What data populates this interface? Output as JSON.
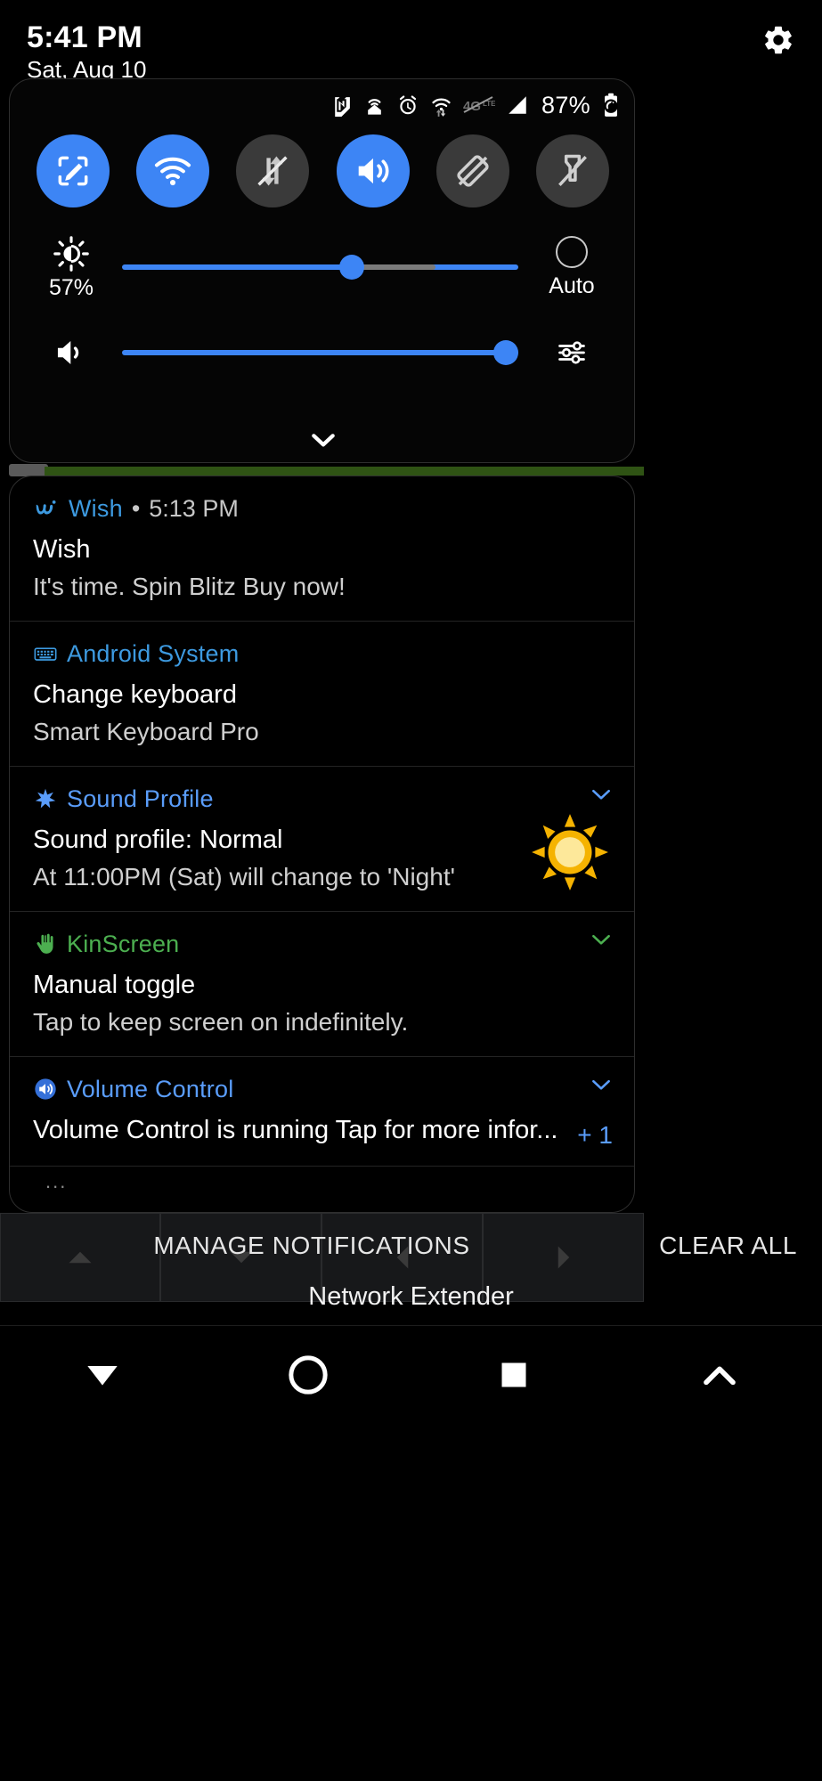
{
  "statusbar_clock": {
    "time": "5:41 PM",
    "date": "Sat, Aug 10",
    "settings_icon": "gear-icon"
  },
  "statusbar": {
    "icons": [
      "nfc-icon",
      "smart-home-icon",
      "alarm-icon",
      "wifi-transfer-icon",
      "4g-lte-disabled-icon",
      "signal-bars-icon"
    ],
    "battery_percent": "87%",
    "battery_icon": "battery-charging-icon",
    "network_label": "4G LTE"
  },
  "quick_settings": {
    "toggles": [
      {
        "name": "screenshot-markup-toggle",
        "icon": "capture-pen-icon",
        "state": "on"
      },
      {
        "name": "wifi-toggle",
        "icon": "wifi-icon",
        "state": "on"
      },
      {
        "name": "mobile-data-toggle",
        "icon": "data-off-icon",
        "state": "off"
      },
      {
        "name": "sound-toggle",
        "icon": "volume-on-icon",
        "state": "on"
      },
      {
        "name": "auto-rotate-toggle",
        "icon": "rotate-locked-icon",
        "state": "off"
      },
      {
        "name": "flashlight-toggle",
        "icon": "flashlight-off-icon",
        "state": "off"
      }
    ],
    "brightness": {
      "icon": "brightness-icon",
      "value_label": "57%",
      "value": 57,
      "auto_label": "Auto",
      "auto_enabled": false
    },
    "volume": {
      "icon": "speaker-icon",
      "value": 100,
      "settings_icon": "sliders-icon"
    },
    "expand_icon": "chevron-down-icon"
  },
  "notifications": [
    {
      "app": "Wish",
      "app_color": "#3d9ae0",
      "icon": "wish-logo-icon",
      "separator": "•",
      "time": "5:13 PM",
      "title": "Wish",
      "body": "It's time. Spin Blitz Buy now!",
      "has_chevron": false,
      "badge": "",
      "art": ""
    },
    {
      "app": "Android System",
      "app_color": "#3d9ae0",
      "icon": "keyboard-icon",
      "separator": "",
      "time": "",
      "title": "Change keyboard",
      "body": "Smart Keyboard Pro",
      "has_chevron": false,
      "badge": "",
      "art": ""
    },
    {
      "app": "Sound Profile",
      "app_color": "#5a9dfb",
      "icon": "sound-profile-star-icon",
      "separator": "",
      "time": "",
      "title": "Sound profile: Normal",
      "body": "At 11:00PM (Sat) will change to 'Night'",
      "has_chevron": true,
      "badge": "",
      "art": "sun-icon"
    },
    {
      "app": "KinScreen",
      "app_color": "#4caf50",
      "icon": "kinscreen-hand-icon",
      "separator": "",
      "time": "",
      "title": "Manual toggle",
      "body": "Tap to keep screen on indefinitely.",
      "has_chevron": true,
      "badge": "",
      "art": ""
    },
    {
      "app": "Volume Control",
      "app_color": "#5a9dfb",
      "icon": "volume-control-icon",
      "separator": "",
      "time": "",
      "title": "Volume Control is running Tap for more infor...",
      "body": "",
      "has_chevron": true,
      "badge": "+ 1",
      "art": ""
    }
  ],
  "shade_overflow": "...",
  "footer": {
    "manage_label": "MANAGE NOTIFICATIONS",
    "clear_label": "CLEAR ALL"
  },
  "background_app": {
    "label": "Network Extender",
    "tiles": [
      "up-arrow-icon",
      "down-arrow-icon",
      "left-arrow-icon",
      "right-arrow-icon"
    ]
  },
  "navbar": {
    "buttons": [
      {
        "name": "nav-down-button",
        "icon": "triangle-down-icon"
      },
      {
        "name": "nav-home-button",
        "icon": "circle-icon"
      },
      {
        "name": "nav-recents-button",
        "icon": "square-icon"
      },
      {
        "name": "nav-up-button",
        "icon": "chevron-up-icon"
      }
    ]
  },
  "colors": {
    "accent_blue": "#3d85f5",
    "toggle_off": "#3a3a3a",
    "panel_bg": "#050505",
    "green_strip": "#2f5314"
  }
}
